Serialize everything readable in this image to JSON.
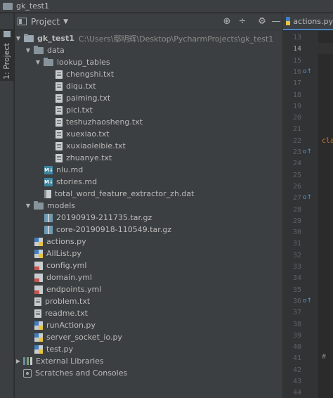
{
  "window": {
    "title": "gk_test1"
  },
  "side_tool_window": {
    "label": "1: Project"
  },
  "project_panel": {
    "title": "Project",
    "toolbar": {
      "locate_icon": "crosshair-icon",
      "collapse_icon": "collapse-icon",
      "settings_icon": "gear-icon",
      "hide_icon": "minimize-icon"
    },
    "root": {
      "name": "gk_test1",
      "path": "C:\\Users\\鄢明辉\\Desktop\\PycharmProjects\\gk_test1"
    },
    "tree": [
      {
        "label": "data",
        "type": "folder",
        "expanded": true
      },
      {
        "label": "lookup_tables",
        "type": "folder",
        "expanded": true
      },
      {
        "label": "chengshi.txt",
        "type": "txt"
      },
      {
        "label": "diqu.txt",
        "type": "txt"
      },
      {
        "label": "paiming.txt",
        "type": "txt"
      },
      {
        "label": "pici.txt",
        "type": "txt"
      },
      {
        "label": "teshuzhaosheng.txt",
        "type": "txt"
      },
      {
        "label": "xuexiao.txt",
        "type": "txt"
      },
      {
        "label": "xuxiaoleibie.txt",
        "type": "txt"
      },
      {
        "label": "zhuanye.txt",
        "type": "txt"
      },
      {
        "label": "nlu.md",
        "type": "md"
      },
      {
        "label": "stories.md",
        "type": "md"
      },
      {
        "label": "total_word_feature_extractor_zh.dat",
        "type": "dat"
      },
      {
        "label": "models",
        "type": "folder",
        "expanded": true
      },
      {
        "label": "20190919-211735.tar.gz",
        "type": "gz"
      },
      {
        "label": "core-20190918-110549.tar.gz",
        "type": "gz"
      },
      {
        "label": "actions.py",
        "type": "py"
      },
      {
        "label": "AllList.py",
        "type": "py"
      },
      {
        "label": "config.yml",
        "type": "yml"
      },
      {
        "label": "domain.yml",
        "type": "yml"
      },
      {
        "label": "endpoints.yml",
        "type": "yml"
      },
      {
        "label": "problem.txt",
        "type": "txt"
      },
      {
        "label": "readme.txt",
        "type": "txt"
      },
      {
        "label": "runAction.py",
        "type": "py"
      },
      {
        "label": "server_socket_io.py",
        "type": "py"
      },
      {
        "label": "test.py",
        "type": "py"
      },
      {
        "label": "External Libraries",
        "type": "extlib"
      },
      {
        "label": "Scratches and Consoles",
        "type": "scratch"
      }
    ]
  },
  "editor": {
    "tab_label": "actions.py",
    "line_numbers": [
      "13",
      "14",
      "15",
      "16",
      "17",
      "18",
      "19",
      "20",
      "21",
      "22",
      "23",
      "24",
      "25",
      "26",
      "27",
      "28",
      "29",
      "30",
      "31",
      "32",
      "33",
      "34",
      "35",
      "36",
      "37",
      "38",
      "39",
      "40",
      "41",
      "42",
      "43",
      "44"
    ],
    "current_line": "14",
    "code_fragments": [
      "cla",
      "#"
    ]
  },
  "colors": {
    "panel_bg": "#3c3f41",
    "editor_bg": "#2b2b2b",
    "accent": "#4a88c7",
    "text": "#bbbbbb"
  }
}
